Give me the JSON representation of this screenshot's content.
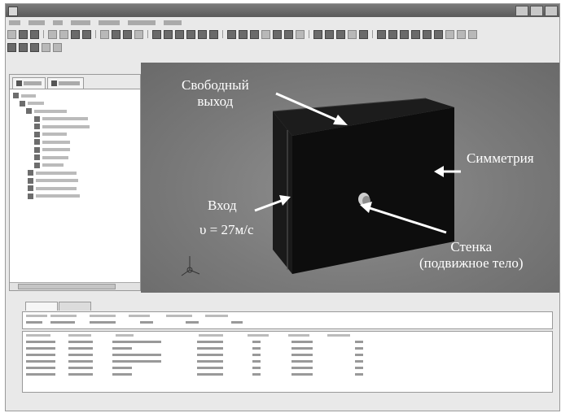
{
  "annotations": {
    "outlet": "Свободный\nвыход",
    "symmetry": "Симметрия",
    "inlet": "Вход",
    "velocity": "υ = 27м/с",
    "wall": "Стенка\n(подвижное тело)"
  },
  "accent_colors": {
    "viewport_bg": "#808080",
    "body": "#0a0a0a",
    "annotation_text": "#ffffff"
  }
}
